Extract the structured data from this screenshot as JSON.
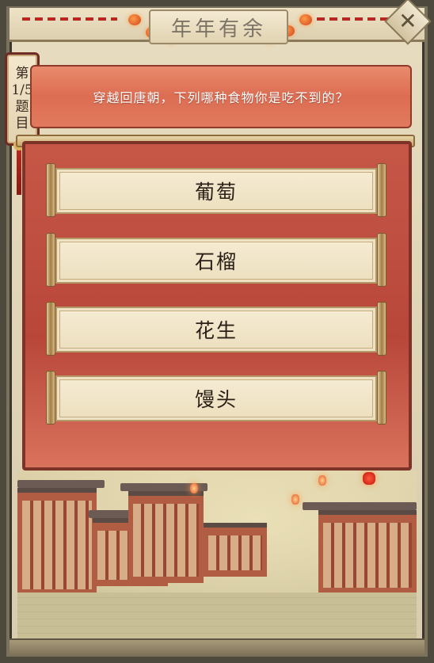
{
  "header": {
    "title": "年年有余",
    "close_label": "✕"
  },
  "progress": {
    "line1": "第",
    "count": "1/5",
    "line3": "题",
    "line4": "目",
    "current": 1,
    "total": 5
  },
  "question": {
    "text": "穿越回唐朝，下列哪种食物你是吃不到的？"
  },
  "options": [
    {
      "label": "葡萄"
    },
    {
      "label": "石榴"
    },
    {
      "label": "花生"
    },
    {
      "label": "馒头"
    }
  ],
  "colors": {
    "accent_red": "#c65747",
    "scroll_red": "#e07a5e",
    "paper": "#f3e8cd",
    "frame": "#4d493c"
  }
}
